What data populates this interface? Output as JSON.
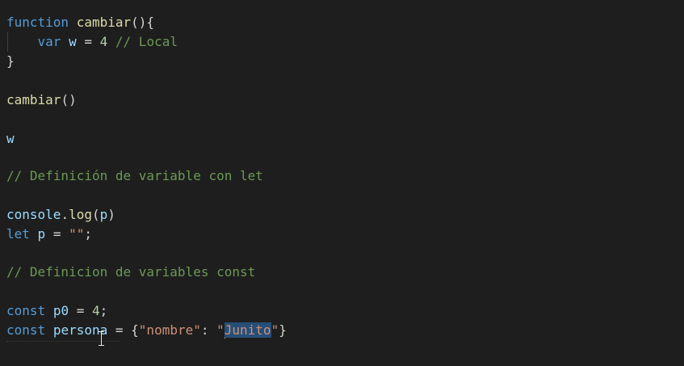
{
  "editor": {
    "lines": {
      "l1": {
        "kw": "function",
        "sp": " ",
        "fn": "cambiar",
        "pun": "(){"
      },
      "l2": {
        "indent": "    ",
        "kw": "var",
        "sp1": " ",
        "var": "w",
        "op": " = ",
        "num": "4",
        "sp2": " ",
        "cmt": "// Local"
      },
      "l3": {
        "pun": "}"
      },
      "l5": {
        "fn": "cambiar",
        "pun": "()"
      },
      "l7": {
        "var": "w"
      },
      "l9": {
        "cmt": "// Definición de variable con let"
      },
      "l11": {
        "var": "console",
        "dot": ".",
        "fn": "log",
        "p1": "(",
        "arg": "p",
        "p2": ")"
      },
      "l12": {
        "kw": "let",
        "sp": " ",
        "var": "p",
        "op": " = ",
        "str": "\"\"",
        "semi": ";"
      },
      "l14": {
        "cmt": "// Definicion de variables const"
      },
      "l16": {
        "kw": "const",
        "sp": " ",
        "var": "p0",
        "op": " = ",
        "num": "4",
        "semi": ";"
      },
      "l17": {
        "kw": "const",
        "sp": " ",
        "var": "persona",
        "op": " = ",
        "brace_open": "{",
        "key": "\"nombre\"",
        "colon": ": ",
        "str_open": "\"",
        "str_sel": "Junito",
        "str_close": "\"",
        "brace_close": "}"
      }
    }
  },
  "colors": {
    "background": "#1e1e1e",
    "keyword": "#569cd6",
    "function": "#dcdcaa",
    "variable": "#9cdcfe",
    "number": "#b5cea8",
    "comment": "#6a9955",
    "string": "#ce9178",
    "selection": "#264f78"
  },
  "icons": {
    "cursor": "text-ibeam-icon"
  }
}
